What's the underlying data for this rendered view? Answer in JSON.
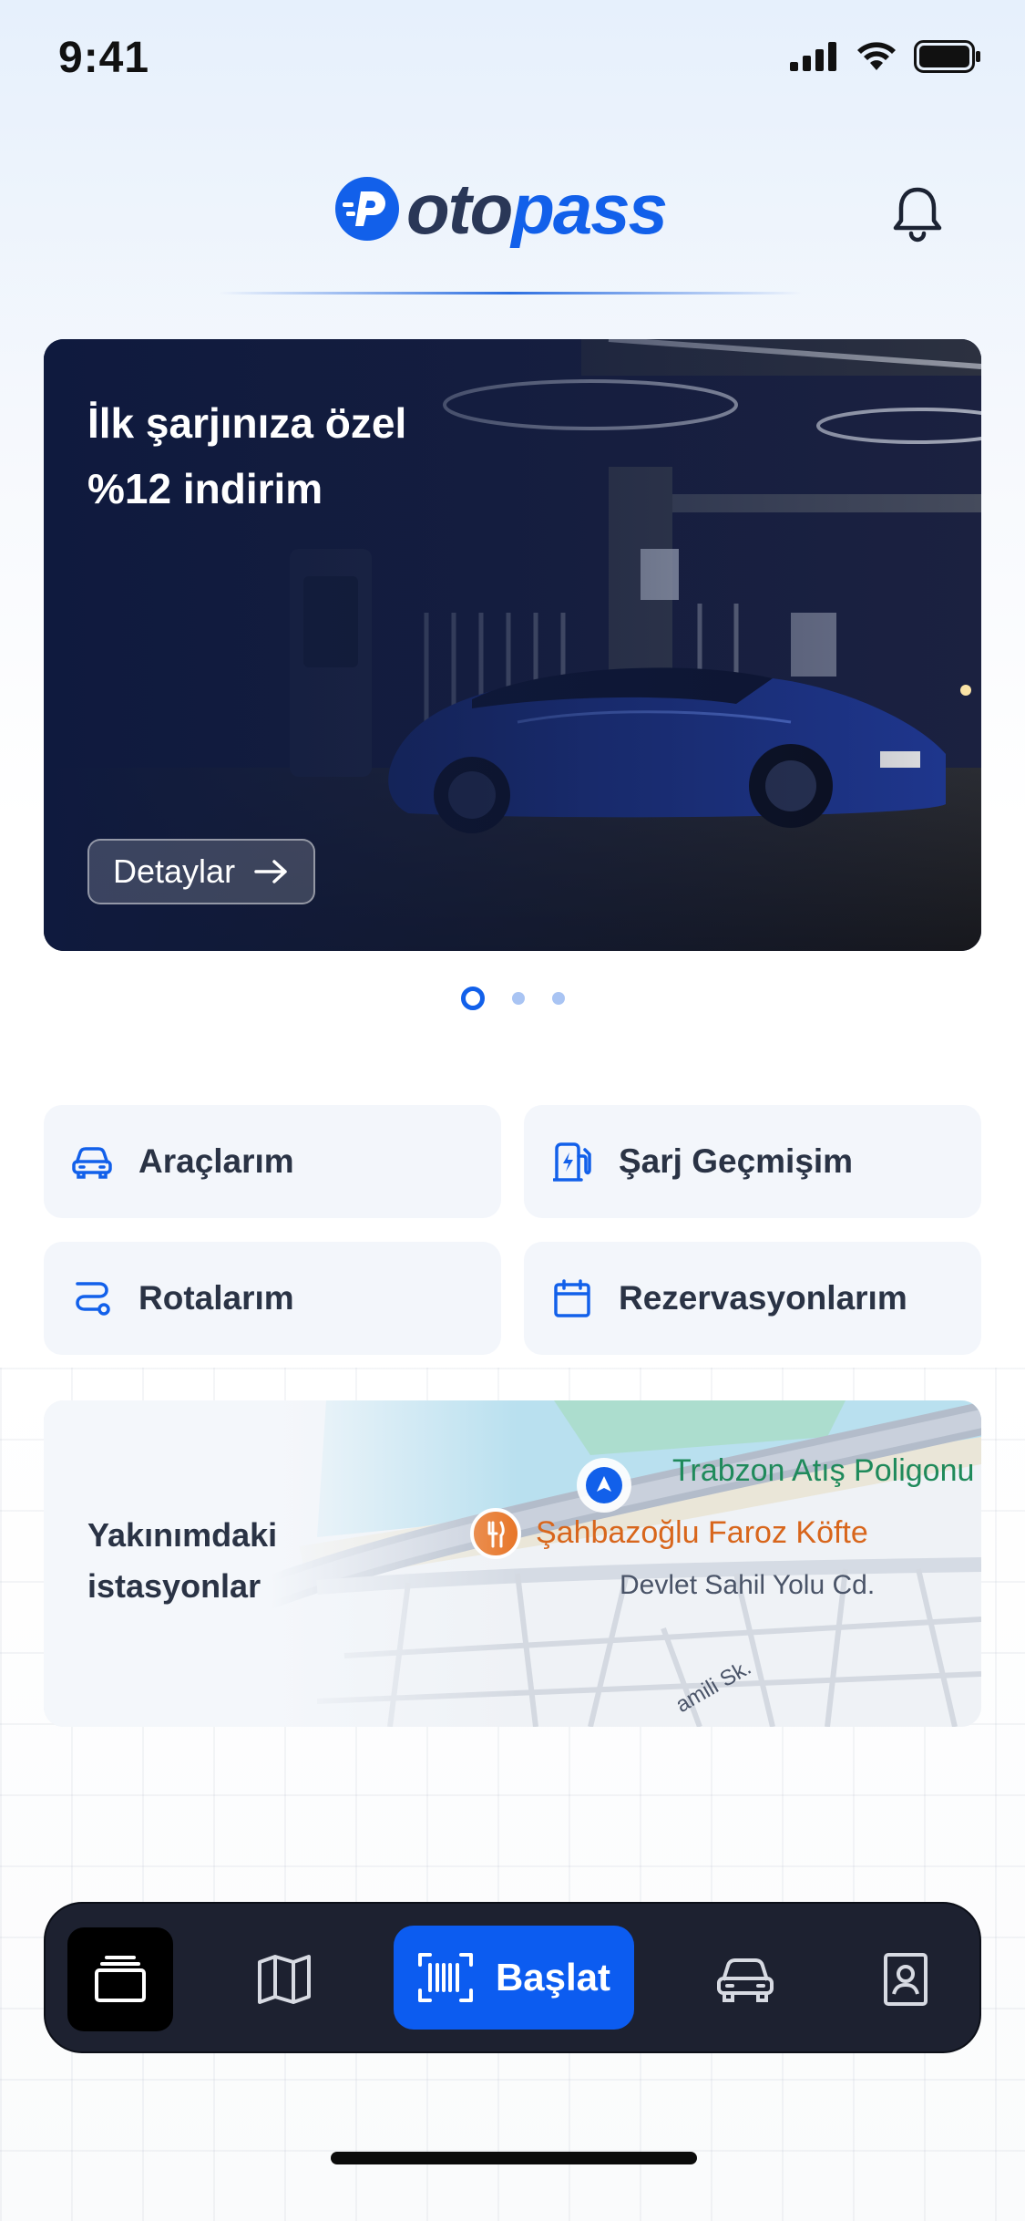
{
  "status_bar": {
    "time": "9:41"
  },
  "header": {
    "logo_oto": "oto",
    "logo_pass": "pass",
    "bell_icon": "bell-icon"
  },
  "banner": {
    "title_line1": "İlk şarjınıza özel",
    "title_line2": "%12 indirim",
    "button_label": "Detaylar",
    "carousel_dots": 3,
    "active_dot": 1
  },
  "quick_actions": [
    {
      "label": "Araçlarım",
      "icon": "car-icon"
    },
    {
      "label": "Şarj Geçmişim",
      "icon": "fuel-station-icon"
    },
    {
      "label": "Rotalarım",
      "icon": "route-icon"
    },
    {
      "label": "Rezervasyonlarım",
      "icon": "calendar-icon"
    }
  ],
  "nearby": {
    "label_line1": "Yakınımdaki",
    "label_line2": "istasyonlar",
    "map_labels": {
      "place1": "Trabzon Atış Poligonu",
      "place2": "Şahbazoğlu Faroz Köfte",
      "road1": "Devlet Sahil Yolu Cd.",
      "street1": "amili Sk."
    }
  },
  "bottom_nav": {
    "start_label": "Başlat",
    "items": [
      "cards-icon",
      "map-icon",
      "barcode-icon",
      "car-icon",
      "profile-card-icon"
    ],
    "active_index": 0
  },
  "colors": {
    "brand": "#1260ea",
    "nav_bg": "#1d2130",
    "accent_orange": "#e8772a",
    "map_green": "#1f8a5b"
  }
}
